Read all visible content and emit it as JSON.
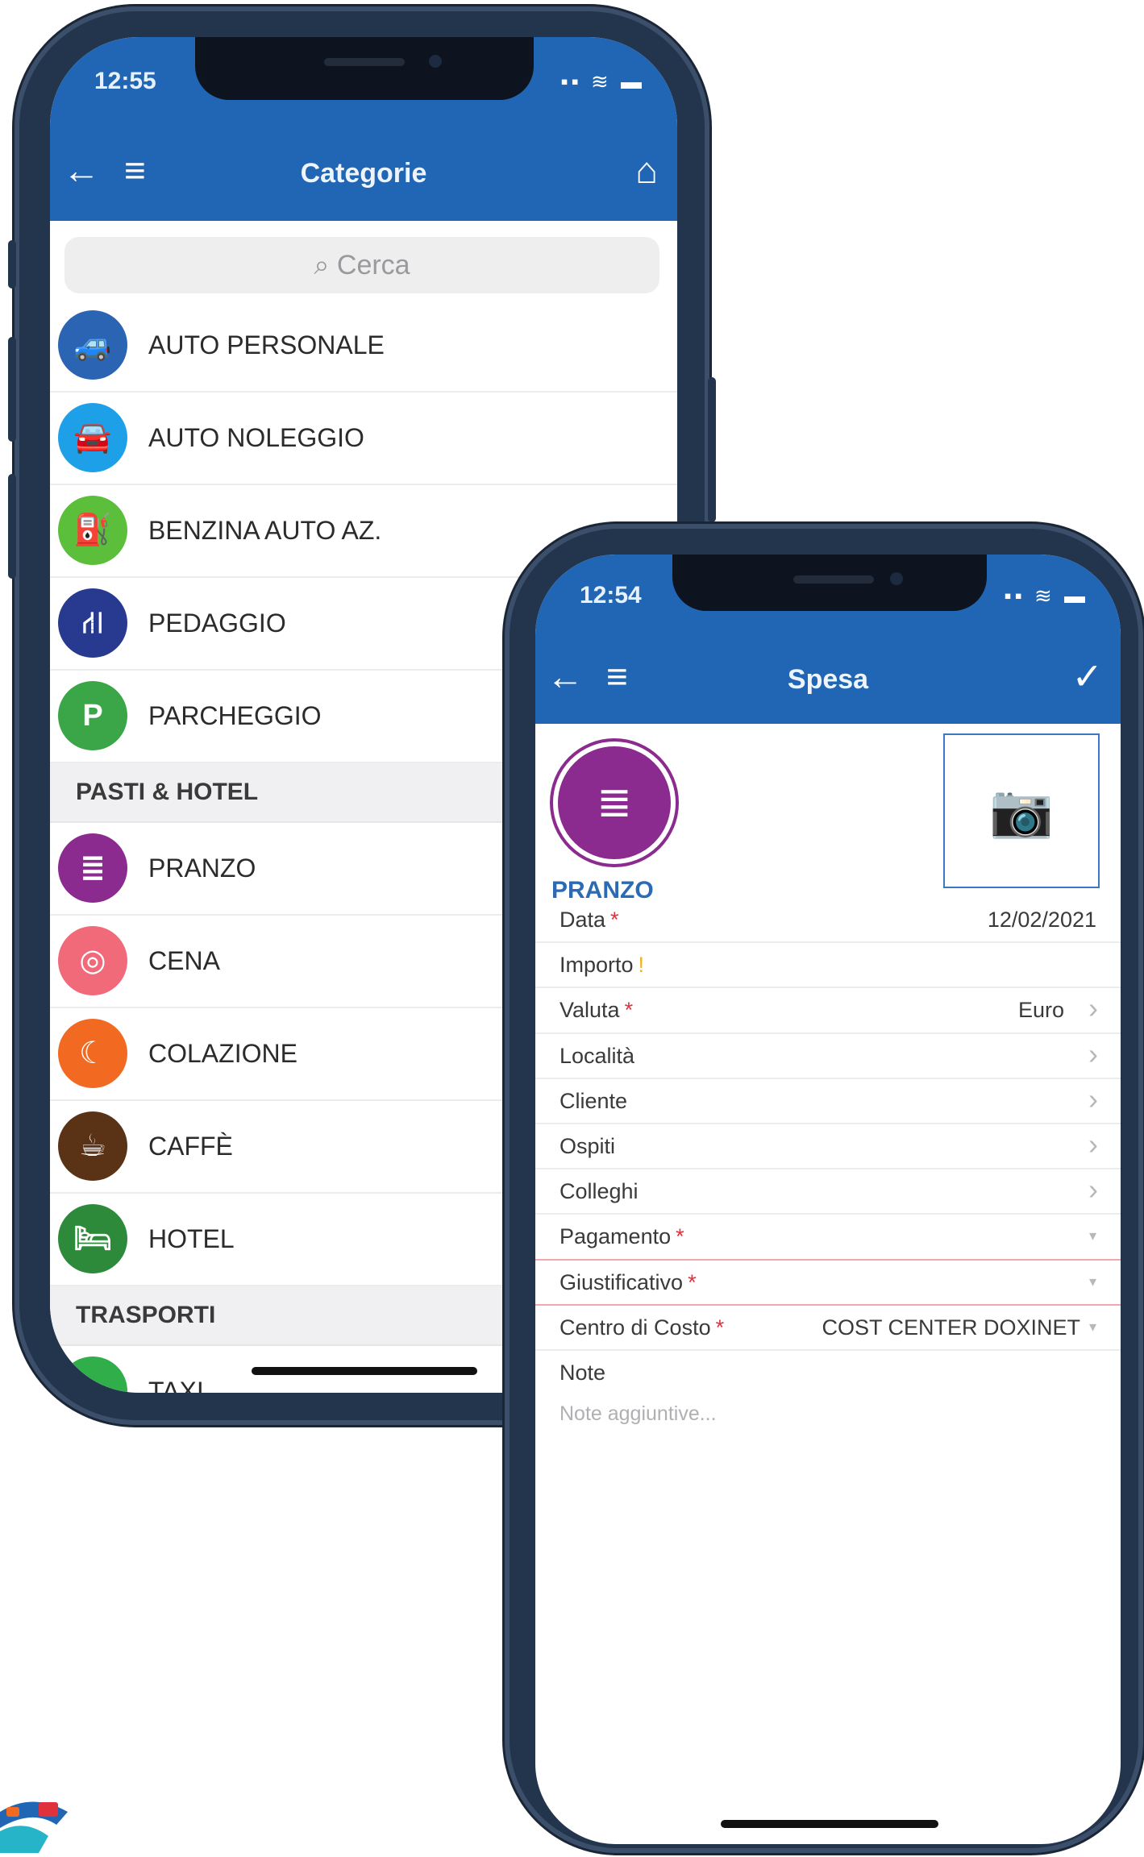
{
  "left_phone": {
    "status_time": "12:55",
    "status_icons": "▪▪ ≋ ▬",
    "nav_title": "Categorie",
    "icons": {
      "back": "arrow-left-icon",
      "menu": "hamburger-menu-icon",
      "home": "home-icon"
    },
    "search_placeholder": "Cerca",
    "items_top": [
      {
        "label": "AUTO PERSONALE",
        "color": "#2a64b3",
        "icon": "car-icon",
        "glyph": "🚙"
      },
      {
        "label": "AUTO NOLEGGIO",
        "color": "#1ea0e8",
        "icon": "rental-car-icon",
        "glyph": "🚘"
      },
      {
        "label": "BENZINA AUTO AZ.",
        "color": "#5cbf3b",
        "icon": "fuel-pump-icon",
        "glyph": "⛽"
      },
      {
        "label": "PEDAGGIO",
        "color": "#283a8f",
        "icon": "highway-toll-icon",
        "glyph": "⛙"
      },
      {
        "label": "PARCHEGGIO",
        "color": "#3aa647",
        "icon": "parking-icon",
        "glyph": "P"
      }
    ],
    "section_meals": "PASTI & HOTEL",
    "items_meals": [
      {
        "label": "PRANZO",
        "color": "#8b2a8f",
        "icon": "lunch-icon",
        "glyph": "≣"
      },
      {
        "label": "CENA",
        "color": "#f06a7a",
        "icon": "dinner-plate-icon",
        "glyph": "◎"
      },
      {
        "label": "COLAZIONE",
        "color": "#f26a21",
        "icon": "croissant-icon",
        "glyph": "☾"
      },
      {
        "label": "CAFFÈ",
        "color": "#5a3317",
        "icon": "coffee-cup-icon",
        "glyph": "☕"
      },
      {
        "label": "HOTEL",
        "color": "#2d8a3a",
        "icon": "hotel-bed-icon",
        "glyph": "🛏"
      }
    ],
    "section_transport": "TRASPORTI",
    "items_transport": [
      {
        "label": "TAXI",
        "color": "#2fae4a",
        "icon": "taxi-icon",
        "glyph": "🚕"
      }
    ]
  },
  "right_phone": {
    "status_time": "12:54",
    "status_icons": "▪▪ ≋ ▬",
    "nav_title": "Spesa",
    "icons": {
      "back": "arrow-left-icon",
      "menu": "hamburger-menu-icon",
      "confirm": "checkmark-icon",
      "camera": "camera-icon",
      "category": "lunch-icon"
    },
    "category_label": "PRANZO",
    "category_color": "#8b2a8f",
    "fields": [
      {
        "label": "Data",
        "marker": "*",
        "value": "12/02/2021",
        "control": "none"
      },
      {
        "label": "Importo",
        "marker": "!",
        "value": "",
        "control": "none"
      },
      {
        "label": "Valuta",
        "marker": "*",
        "value": "Euro",
        "control": "chevron"
      },
      {
        "label": "Località",
        "marker": "",
        "value": "",
        "control": "chevron"
      },
      {
        "label": "Cliente",
        "marker": "",
        "value": "",
        "control": "chevron"
      },
      {
        "label": "Ospiti",
        "marker": "",
        "value": "",
        "control": "chevron"
      },
      {
        "label": "Colleghi",
        "marker": "",
        "value": "",
        "control": "chevron"
      },
      {
        "label": "Pagamento",
        "marker": "*",
        "value": "",
        "control": "dropdown"
      },
      {
        "label": "Giustificativo",
        "marker": "*",
        "value": "",
        "control": "dropdown"
      },
      {
        "label": "Centro di Costo",
        "marker": "*",
        "value": "COST CENTER DOXINET",
        "control": "dropdown"
      }
    ],
    "note_label": "Note",
    "note_placeholder": "Note aggiuntive..."
  },
  "colors": {
    "primary": "#2066b4",
    "required": "#e0323c",
    "warning": "#f2b21b"
  }
}
